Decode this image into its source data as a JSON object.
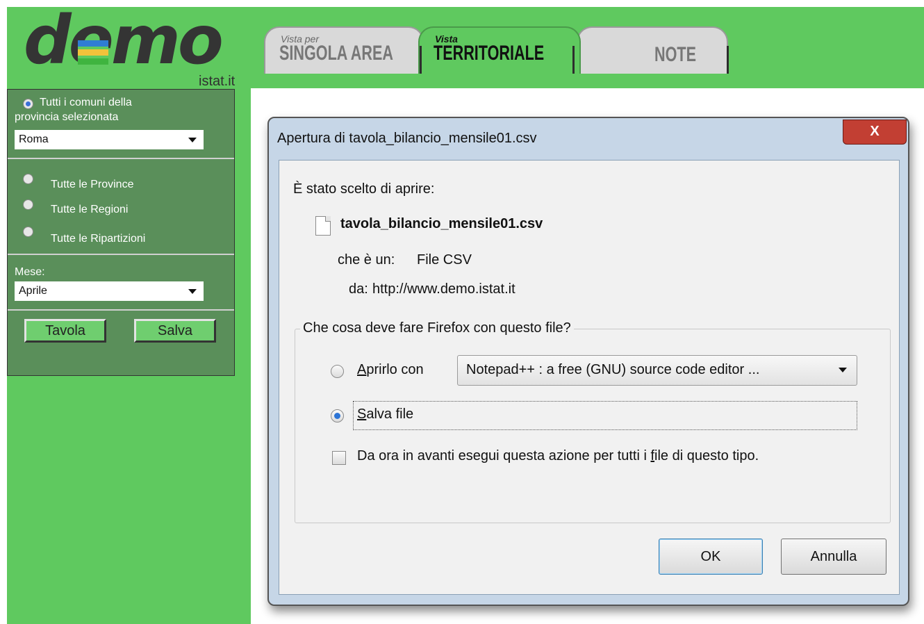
{
  "header": {
    "logo_word": "demo",
    "logo_site": "istat.it",
    "logo_bar_colors": [
      "#2f7dd4",
      "#f2c23b",
      "#3fb43f"
    ],
    "tabs": [
      {
        "small": "Vista per",
        "big": "SINGOLA AREA",
        "active": false
      },
      {
        "small": "Vista",
        "big": "TERRITORIALE",
        "active": true
      },
      {
        "small": "",
        "big": "NOTE",
        "active": false
      }
    ]
  },
  "sidebar": {
    "radio_comuni_line1": "Tutti i comuni della",
    "radio_comuni_line2": "provincia selezionata",
    "province_select": "Roma",
    "radio_province": "Tutte le Province",
    "radio_regioni": "Tutte le Regioni",
    "radio_ripartizioni": "Tutte le Ripartizioni",
    "mese_label": "Mese:",
    "mese_select": "Aprile",
    "btn_tavola": "Tavola",
    "btn_salva": "Salva"
  },
  "dialog": {
    "title": "Apertura di tavola_bilancio_mensile01.csv",
    "close_label": "X",
    "intro": "È stato scelto di aprire:",
    "filename": "tavola_bilancio_mensile01.csv",
    "type_label": "che è un:",
    "type_value": "File CSV",
    "from_label": "da:",
    "from_value": "http://www.demo.istat.it",
    "question": "Che cosa deve fare Firefox con questo file?",
    "open_with_prefix": "A",
    "open_with_rest": "prirlo con",
    "app_select": "Notepad++ : a free (GNU) source code editor ...",
    "save_prefix": "S",
    "save_rest": "alva file",
    "remember_a": "Da ora in avanti esegui questa azione per tutti i ",
    "remember_u": "f",
    "remember_b": "ile di questo tipo.",
    "ok": "OK",
    "cancel": "Annulla"
  },
  "colors": {
    "page_green": "#5fc95f",
    "panel_green": "#5a8f5a",
    "dialog_frame": "#c6d6e7",
    "close_red": "#c23f33"
  }
}
